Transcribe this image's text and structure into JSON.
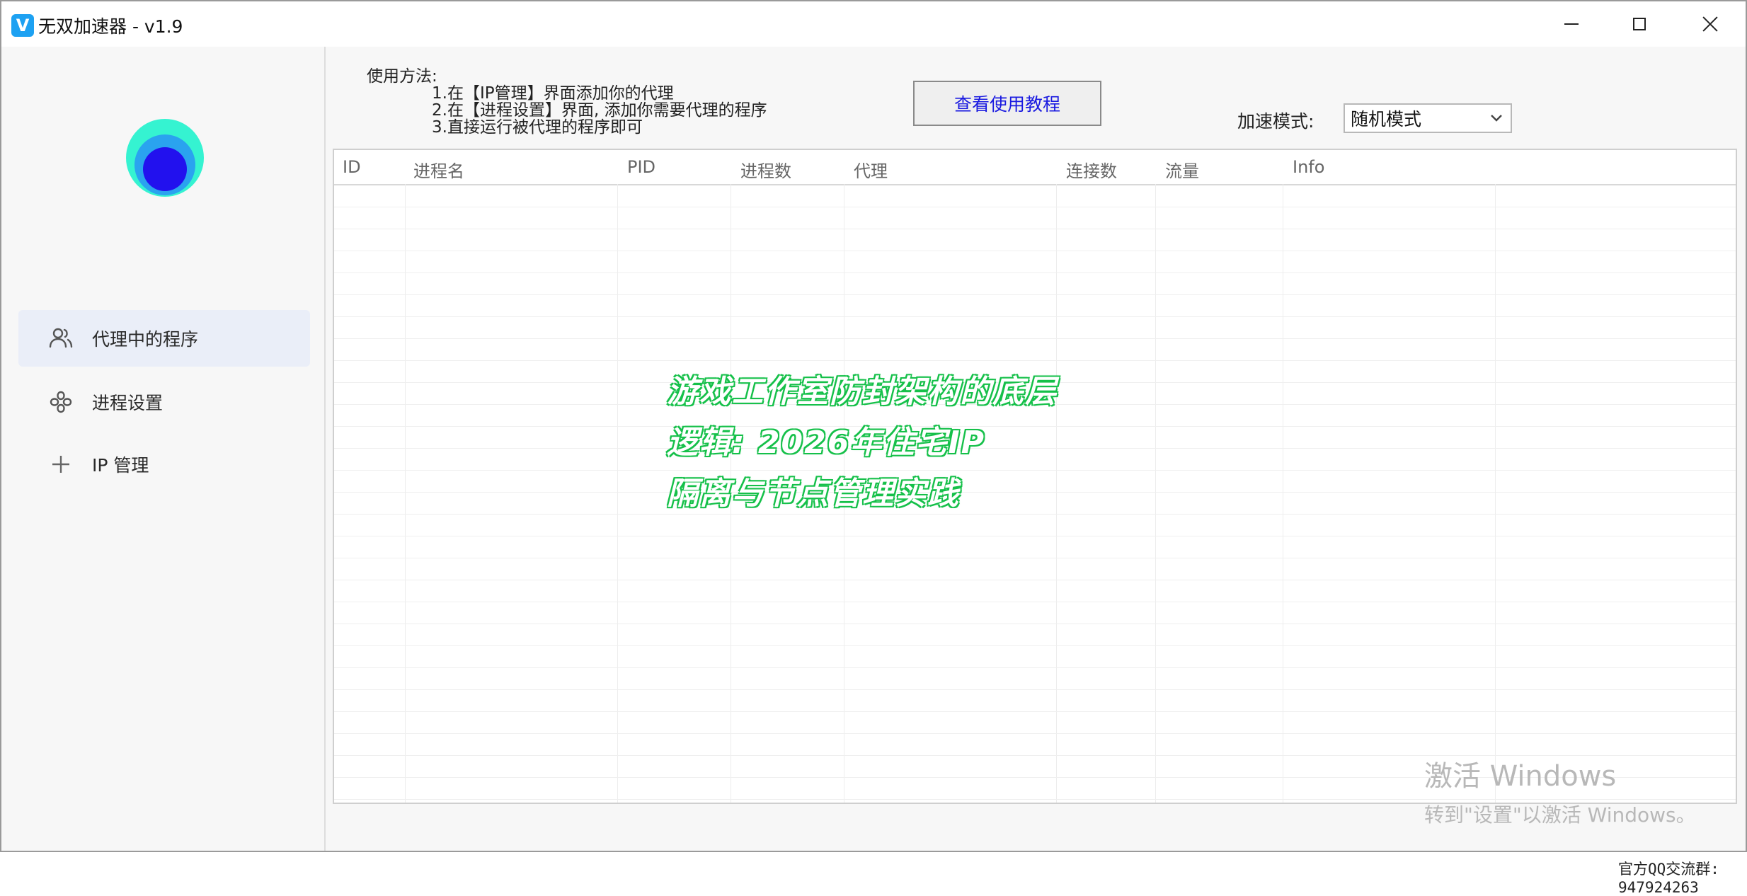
{
  "window": {
    "title": "无双加速器 - v1.9",
    "app_icon_letter": "V"
  },
  "sidebar": {
    "items": [
      {
        "label": "代理中的程序",
        "icon": "users-icon",
        "active": true
      },
      {
        "label": "进程设置",
        "icon": "process-icon",
        "active": false
      },
      {
        "label": "IP 管理",
        "icon": "plus-icon",
        "active": false
      }
    ]
  },
  "usage": {
    "heading": "使用方法:",
    "steps": [
      "1.在【IP管理】界面添加你的代理",
      "2.在【进程设置】界面, 添加你需要代理的程序",
      "3.直接运行被代理的程序即可"
    ]
  },
  "toolbar": {
    "tutorial_button": "查看使用教程",
    "mode_label": "加速模式:",
    "mode_value": "随机模式"
  },
  "table": {
    "columns": [
      "ID",
      "进程名",
      "PID",
      "进程数",
      "代理",
      "连接数",
      "流量",
      "Info"
    ]
  },
  "overlay": {
    "lines": [
      "游戏工作室防封架构的底层",
      "逻辑: 2026年住宅IP",
      "隔离与节点管理实践"
    ]
  },
  "footer": {
    "qq_label": "官方QQ交流群:",
    "qq_number": "947924263"
  },
  "watermark": {
    "line1": "激活 Windows",
    "line2": "转到\"设置\"以激活 Windows。"
  },
  "colors": {
    "accent": "#1a1ae0",
    "active_nav": "#eaeef8",
    "overlay_outline": "#16c04a"
  }
}
